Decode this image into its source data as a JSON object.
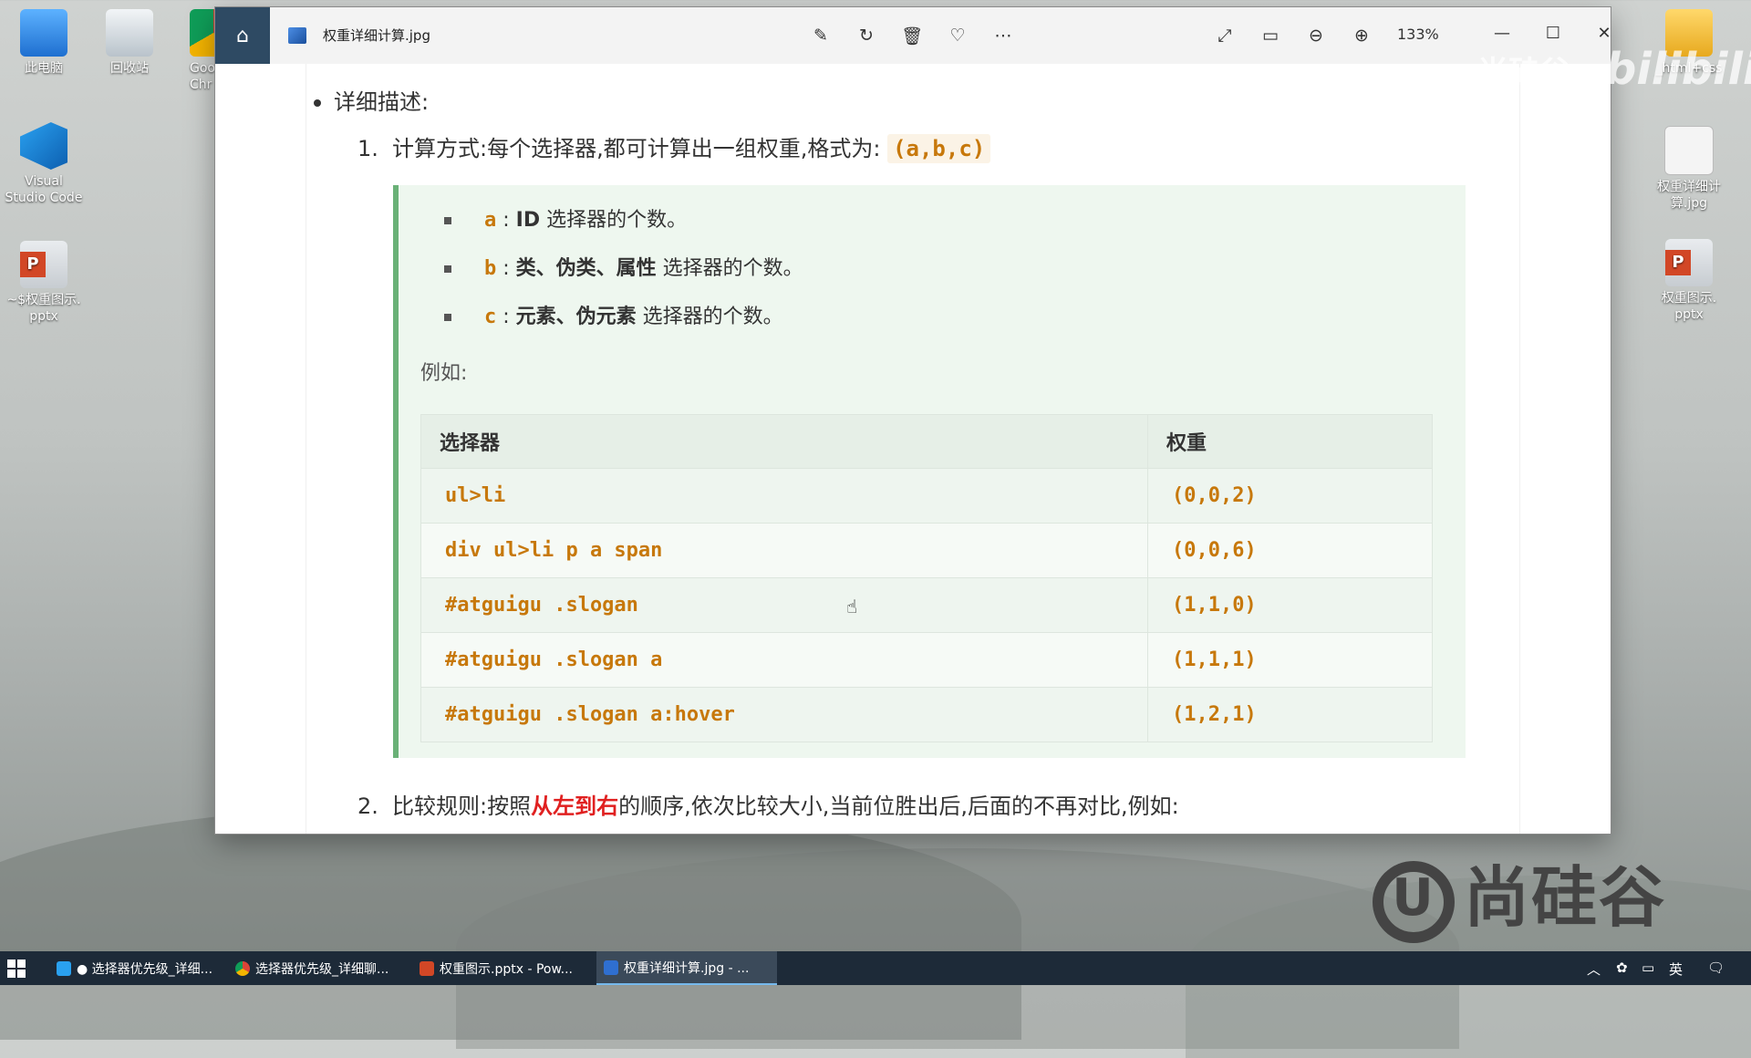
{
  "desktop": {
    "icons_left": [
      {
        "label": "此电脑",
        "icon": "computer-icon"
      },
      {
        "label": "回收站",
        "icon": "recycle-bin-icon"
      },
      {
        "label": "Goo\nChr",
        "icon": "chrome-icon"
      },
      {
        "label": "Visual\nStudio Code",
        "icon": "vscode-icon"
      },
      {
        "label": "~$权重图示.\npptx",
        "icon": "pptx-file-icon"
      }
    ],
    "icons_right": [
      {
        "label": "_html+css",
        "icon": "folder-icon"
      },
      {
        "label": "权重详细计\n算.jpg",
        "icon": "jpg-file-icon"
      },
      {
        "label": "权重图示.\npptx",
        "icon": "pptx-file-icon"
      }
    ]
  },
  "viewer": {
    "file_name": "权重详细计算.jpg",
    "zoom": "133%",
    "toolbar": [
      "edit-icon",
      "rotate-icon",
      "delete-icon",
      "favorite-icon",
      "more-icon"
    ],
    "right_tools": [
      "fullscreen-icon",
      "fit-icon",
      "zoom-out-icon",
      "zoom-in-icon"
    ]
  },
  "content": {
    "heading": "详细描述:",
    "item1": {
      "num": "1.",
      "text": "计算方式:每个选择器,都可计算出一组权重,格式为:",
      "code": "(a,b,c)"
    },
    "list": [
      {
        "key": "a",
        "strong": "ID",
        "rest": " 选择器的个数。"
      },
      {
        "key": "b",
        "strong": "类、伪类、属性",
        "rest": " 选择器的个数。"
      },
      {
        "key": "c",
        "strong": "元素、伪元素",
        "rest": " 选择器的个数。"
      }
    ],
    "example_label": "例如:",
    "table": {
      "headers": [
        "选择器",
        "权重"
      ],
      "rows": [
        [
          "ul>li",
          "(0,0,2)"
        ],
        [
          "div ul>li p a span",
          "(0,0,6)"
        ],
        [
          "#atguigu .slogan",
          "(1,1,0)"
        ],
        [
          "#atguigu .slogan a",
          "(1,1,1)"
        ],
        [
          "#atguigu .slogan a:hover",
          "(1,2,1)"
        ]
      ]
    },
    "item2": {
      "num": "2.",
      "text_before": "比较规则:按照",
      "highlight": "从左到右",
      "text_after": "的顺序,依次比较大小,当前位胜出后,后面的不再对比,例如:"
    }
  },
  "watermarks": {
    "bilibili": "bilibili",
    "brand_top": "尚硅谷",
    "brand_logo": "尚硅谷"
  },
  "taskbar": {
    "items": [
      {
        "label": "● 选择器优先级_详细...",
        "icon": "vscode-icon"
      },
      {
        "label": "选择器优先级_详细聊...",
        "icon": "chrome-icon"
      },
      {
        "label": "权重图示.pptx - Pow...",
        "icon": "powerpoint-icon"
      },
      {
        "label": "权重详细计算.jpg - ...",
        "icon": "photos-icon"
      }
    ],
    "ime": "英"
  },
  "colors": {
    "accent_code": "#c7780b",
    "quote_border": "#6ab177",
    "highlight_red": "#e02020",
    "home_button": "#2e4a63"
  }
}
